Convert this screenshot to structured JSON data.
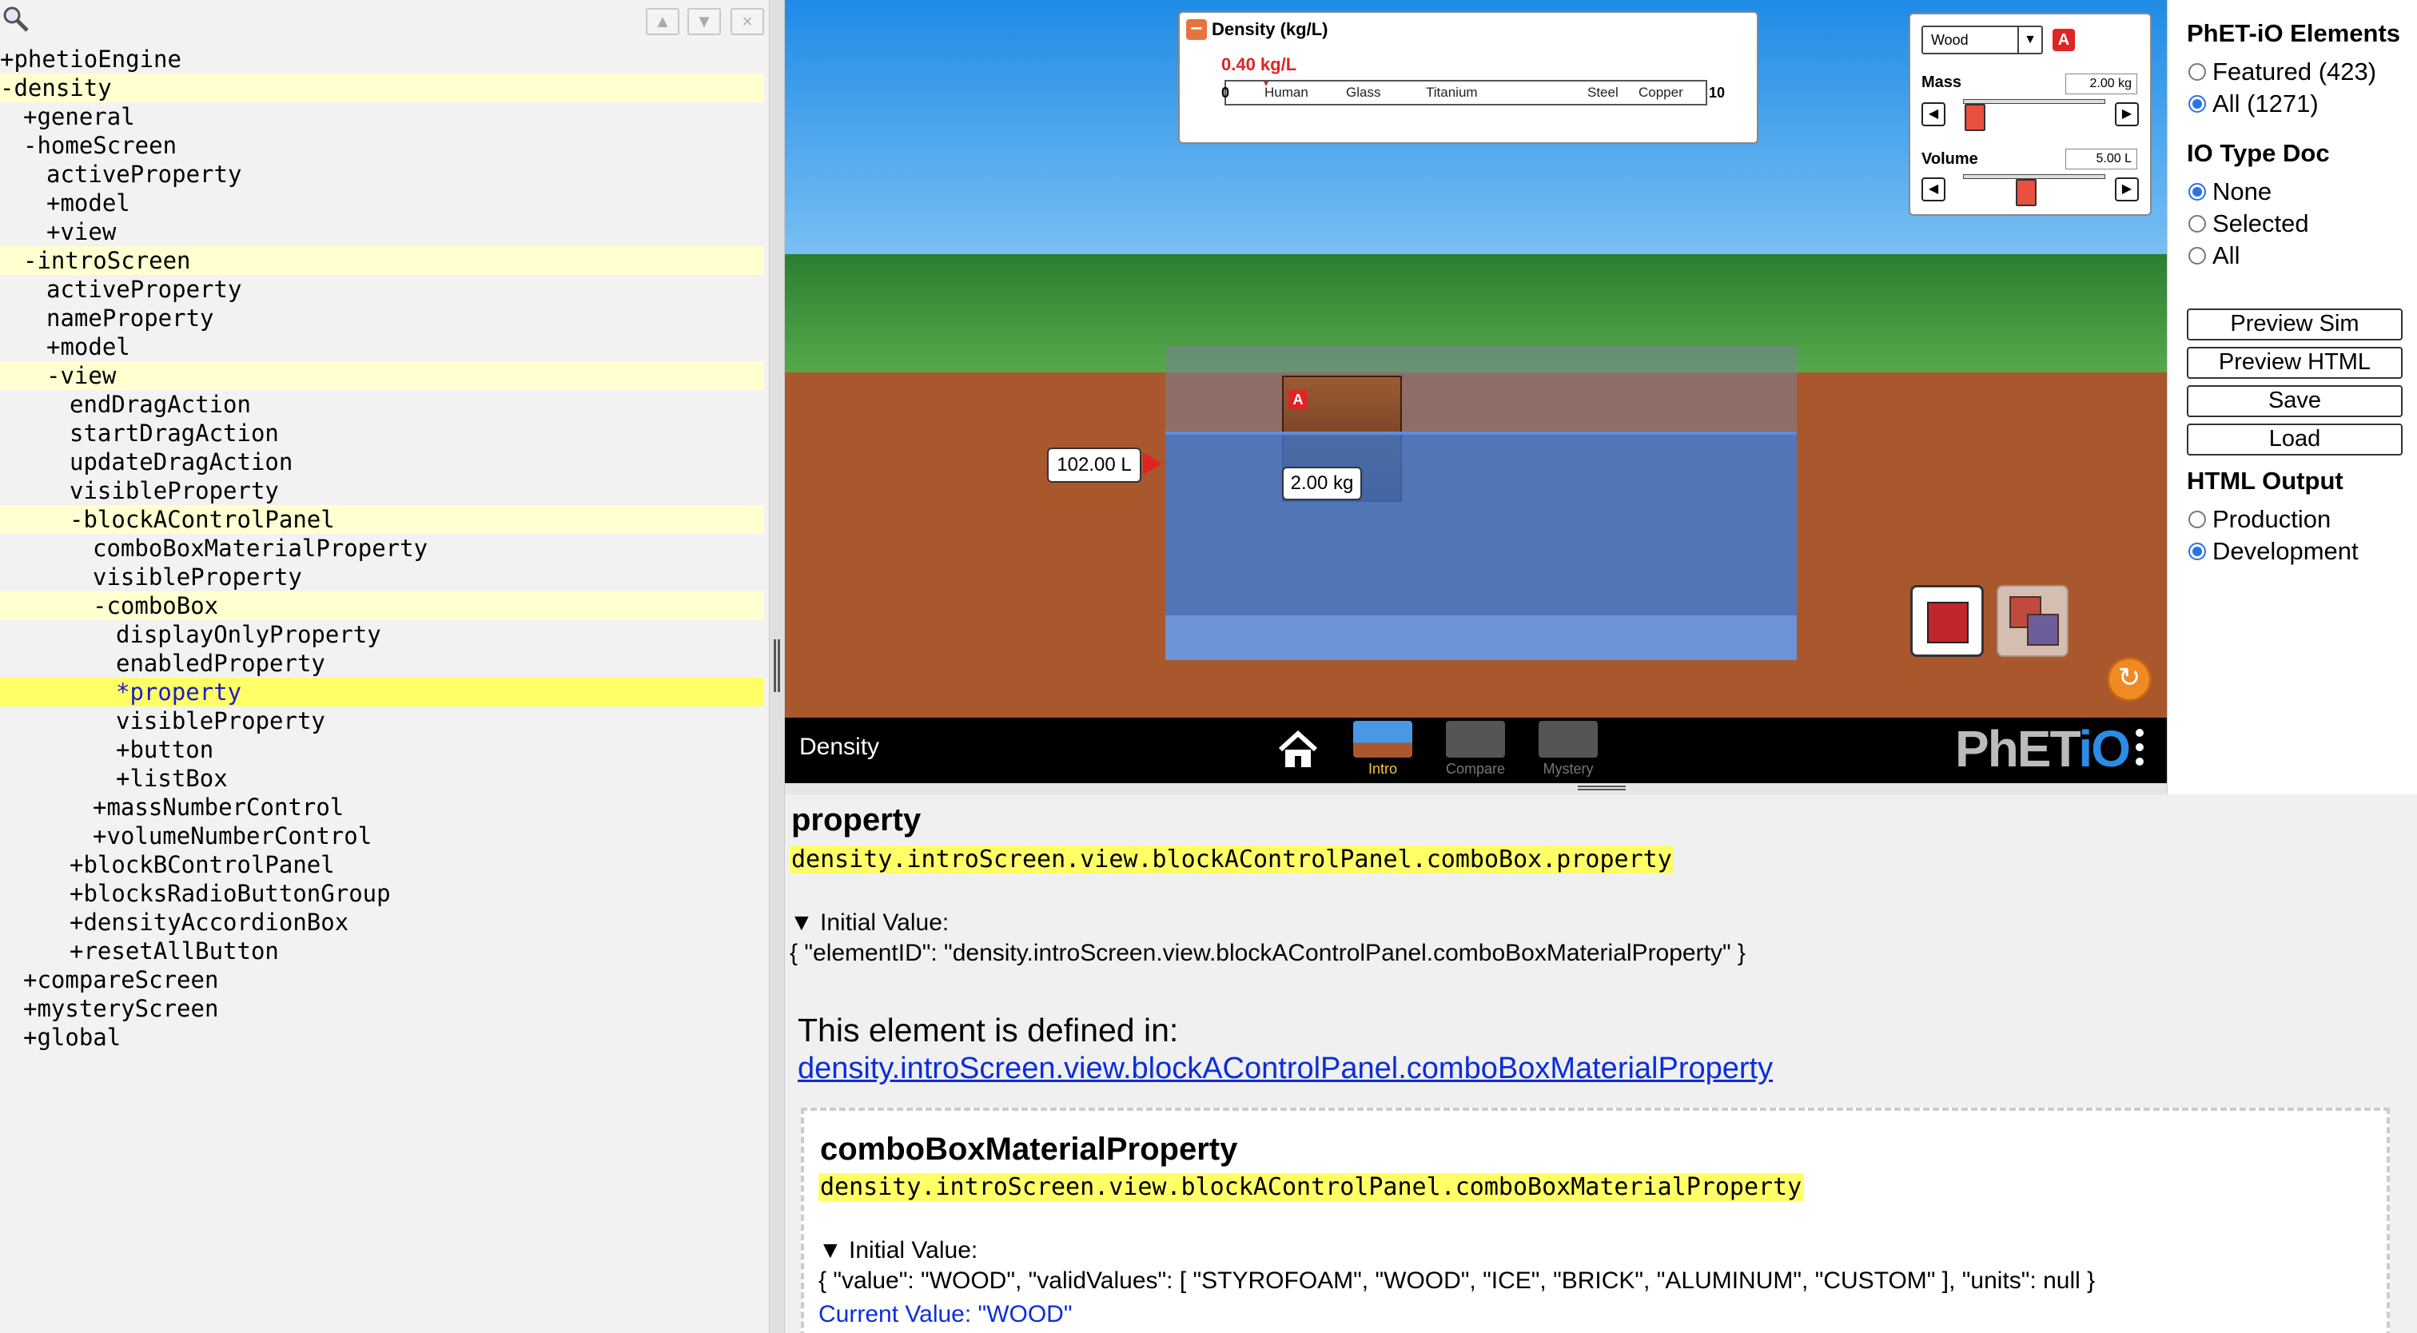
{
  "tree": {
    "nav": {
      "up": "▲",
      "down": "▼",
      "close": "×"
    },
    "rows": [
      {
        "indent": 0,
        "text": "+phetioEngine",
        "hl": false,
        "sel": false
      },
      {
        "indent": 0,
        "text": "-density",
        "hl": true,
        "sel": false
      },
      {
        "indent": 1,
        "text": "+general",
        "hl": false,
        "sel": false
      },
      {
        "indent": 1,
        "text": "-homeScreen",
        "hl": false,
        "sel": false
      },
      {
        "indent": 2,
        "text": "activeProperty",
        "hl": false,
        "sel": false
      },
      {
        "indent": 2,
        "text": "+model",
        "hl": false,
        "sel": false
      },
      {
        "indent": 2,
        "text": "+view",
        "hl": false,
        "sel": false
      },
      {
        "indent": 1,
        "text": "-introScreen",
        "hl": true,
        "sel": false
      },
      {
        "indent": 2,
        "text": "activeProperty",
        "hl": false,
        "sel": false
      },
      {
        "indent": 2,
        "text": "nameProperty",
        "hl": false,
        "sel": false
      },
      {
        "indent": 2,
        "text": "+model",
        "hl": false,
        "sel": false
      },
      {
        "indent": 2,
        "text": "-view",
        "hl": true,
        "sel": false
      },
      {
        "indent": 3,
        "text": "endDragAction",
        "hl": false,
        "sel": false
      },
      {
        "indent": 3,
        "text": "startDragAction",
        "hl": false,
        "sel": false
      },
      {
        "indent": 3,
        "text": "updateDragAction",
        "hl": false,
        "sel": false
      },
      {
        "indent": 3,
        "text": "visibleProperty",
        "hl": false,
        "sel": false
      },
      {
        "indent": 3,
        "text": "-blockAControlPanel",
        "hl": true,
        "sel": false
      },
      {
        "indent": 4,
        "text": "comboBoxMaterialProperty",
        "hl": false,
        "sel": false
      },
      {
        "indent": 4,
        "text": "visibleProperty",
        "hl": false,
        "sel": false
      },
      {
        "indent": 4,
        "text": "-comboBox",
        "hl": true,
        "sel": false
      },
      {
        "indent": 5,
        "text": "displayOnlyProperty",
        "hl": false,
        "sel": false
      },
      {
        "indent": 5,
        "text": "enabledProperty",
        "hl": false,
        "sel": false
      },
      {
        "indent": 5,
        "text": "*property",
        "hl": false,
        "sel": true
      },
      {
        "indent": 5,
        "text": "visibleProperty",
        "hl": false,
        "sel": false
      },
      {
        "indent": 5,
        "text": "+button",
        "hl": false,
        "sel": false
      },
      {
        "indent": 5,
        "text": "+listBox",
        "hl": false,
        "sel": false
      },
      {
        "indent": 4,
        "text": "+massNumberControl",
        "hl": false,
        "sel": false
      },
      {
        "indent": 4,
        "text": "+volumeNumberControl",
        "hl": false,
        "sel": false
      },
      {
        "indent": 3,
        "text": "+blockBControlPanel",
        "hl": false,
        "sel": false
      },
      {
        "indent": 3,
        "text": "+blocksRadioButtonGroup",
        "hl": false,
        "sel": false
      },
      {
        "indent": 3,
        "text": "+densityAccordionBox",
        "hl": false,
        "sel": false
      },
      {
        "indent": 3,
        "text": "+resetAllButton",
        "hl": false,
        "sel": false
      },
      {
        "indent": 1,
        "text": "+compareScreen",
        "hl": false,
        "sel": false
      },
      {
        "indent": 1,
        "text": "+mysteryScreen",
        "hl": false,
        "sel": false
      },
      {
        "indent": 1,
        "text": "+global",
        "hl": false,
        "sel": false
      }
    ]
  },
  "sim": {
    "density_box": {
      "collapse": "−",
      "title": "Density (kg/L)",
      "value": "0.40 kg/L",
      "min": "0",
      "max": "10",
      "materials": [
        "Human",
        "Glass",
        "Titanium",
        "Steel",
        "Copper"
      ]
    },
    "control_panel": {
      "material": "Wood",
      "material_arrow": "▼",
      "block_badge": "A",
      "mass_label": "Mass",
      "mass_value": "2.00 kg",
      "volume_label": "Volume",
      "volume_value": "5.00 L",
      "left_arrow": "◀",
      "right_arrow": "▶"
    },
    "block_badge": "A",
    "block_mass_readout": "2.00 kg",
    "volume_readout": "102.00 L",
    "reset_symbol": "↻",
    "nav": {
      "title": "Density",
      "tabs": [
        "Intro",
        "Compare",
        "Mystery"
      ],
      "logo_phet": "PhET",
      "logo_io": "iO"
    }
  },
  "side": {
    "elements_heading": "PhET-iO Elements",
    "elements_options": [
      "Featured (423)",
      "All (1271)"
    ],
    "iotype_heading": "IO Type Doc",
    "iotype_options": [
      "None",
      "Selected",
      "All"
    ],
    "buttons": [
      "Preview Sim",
      "Preview HTML",
      "Save",
      "Load"
    ],
    "output_heading": "HTML Output",
    "output_options": [
      "Production",
      "Development"
    ]
  },
  "details": {
    "title": "property",
    "path": "density.introScreen.view.blockAControlPanel.comboBox.property",
    "initial_label": "▼ Initial Value:",
    "initial_value": "{ \"elementID\": \"density.introScreen.view.blockAControlPanel.comboBoxMaterialProperty\" }",
    "defined_label": "This element is defined in:",
    "defined_link": "density.introScreen.view.blockAControlPanel.comboBoxMaterialProperty",
    "inner": {
      "title": "comboBoxMaterialProperty",
      "path": "density.introScreen.view.blockAControlPanel.comboBoxMaterialProperty",
      "initial_label": "▼ Initial Value:",
      "initial_value": "{ \"value\": \"WOOD\", \"validValues\": [ \"STYROFOAM\", \"WOOD\", \"ICE\", \"BRICK\", \"ALUMINUM\", \"CUSTOM\" ], \"units\": null }",
      "current_value": "Current Value: \"WOOD\""
    }
  }
}
